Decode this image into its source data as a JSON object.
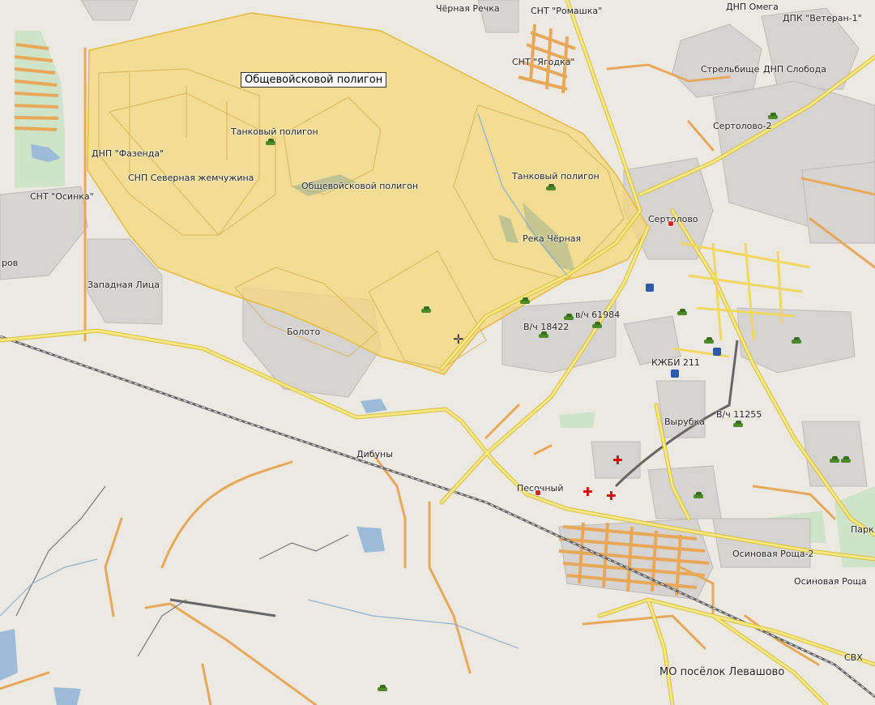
{
  "tooltip": "Общевойсковой полигон",
  "labels": {
    "chernaya_rechka": "Чёрная Речка",
    "snt_romashka": "СНТ \"Ромашка\"",
    "dnp_omega": "ДНП Омега",
    "dpk_veteran": "ДПК \"Ветеран-1\"",
    "snt_yagodka": "СНТ \"Ягодка\"",
    "strelbishche": "Стрельбище",
    "dnp_sloboda": "ДНП Слобода",
    "sertolovo2": "Сертолово-2",
    "dnp_fazenda": "ДНП \"Фазенда\"",
    "tank_polygon1": "Танковый полигон",
    "snp_zhemchuzhina": "СНП Северная жемчужина",
    "obshch_polygon": "Общевойсковой полигон",
    "tank_polygon2": "Танковый полигон",
    "snt_osinka": "СНТ \"Осинка\"",
    "sertolovo": "Сертолово",
    "reka_chernaya": "Река Чёрная",
    "rov": "ров",
    "zapadnaya_litsa": "Западная Лица",
    "vch_61984": "в/ч 61984",
    "vch_18422": "В/ч 18422",
    "boloto": "Болото",
    "kzhbi": "КЖБИ 211",
    "vyrubka": "Вырубка",
    "vch_11255": "В/ч 11255",
    "dibuny": "Дибуны",
    "pesochny": "Песочный",
    "park": "Парк",
    "osinovaya_roshcha2": "Осиновая Роща-2",
    "osinovaya_roshcha": "Осиновая Роща",
    "levashovo": "МО посёлок Левашово",
    "svkh": "СВХ"
  },
  "colors": {
    "background": "#ece9e3",
    "polygon_fill": "#f5d77a",
    "polygon_stroke": "#e8b93a",
    "major_road": "#f4dc5e",
    "minor_road": "#e8a85a",
    "forest": "#cfe3c8",
    "water": "#9cbbd8",
    "built_area": "#d6d4d2",
    "railway": "#666666"
  }
}
